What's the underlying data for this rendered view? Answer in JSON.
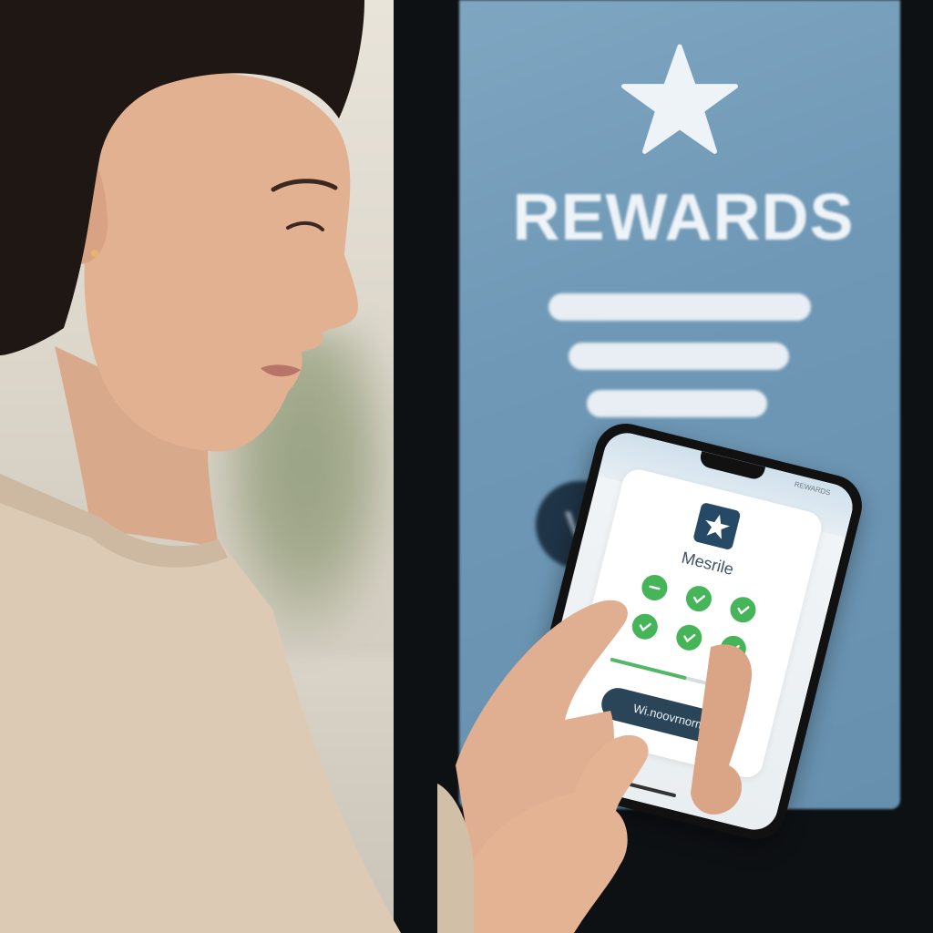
{
  "scene": {
    "kiosk": {
      "title": "REWARDS",
      "cta_label": "VIEW RE",
      "screen_color": "#7fa6c1",
      "cta_color": "#1f3447"
    },
    "phone": {
      "status_time": "REWARDS",
      "app_icon": "star-icon",
      "card_title": "Mesrile",
      "checks": [
        {
          "icon": "dash-icon",
          "state": "done"
        },
        {
          "icon": "check-icon",
          "state": "done"
        },
        {
          "icon": "check-icon",
          "state": "done"
        },
        {
          "icon": "check-icon",
          "state": "done"
        },
        {
          "icon": "check-icon",
          "state": "done"
        },
        {
          "icon": "check-icon",
          "state": "done"
        }
      ],
      "progress_percent": 55,
      "button_label": "Wi.noovrnorm",
      "accent_color": "#46b55a",
      "button_color": "#2b4558"
    }
  }
}
